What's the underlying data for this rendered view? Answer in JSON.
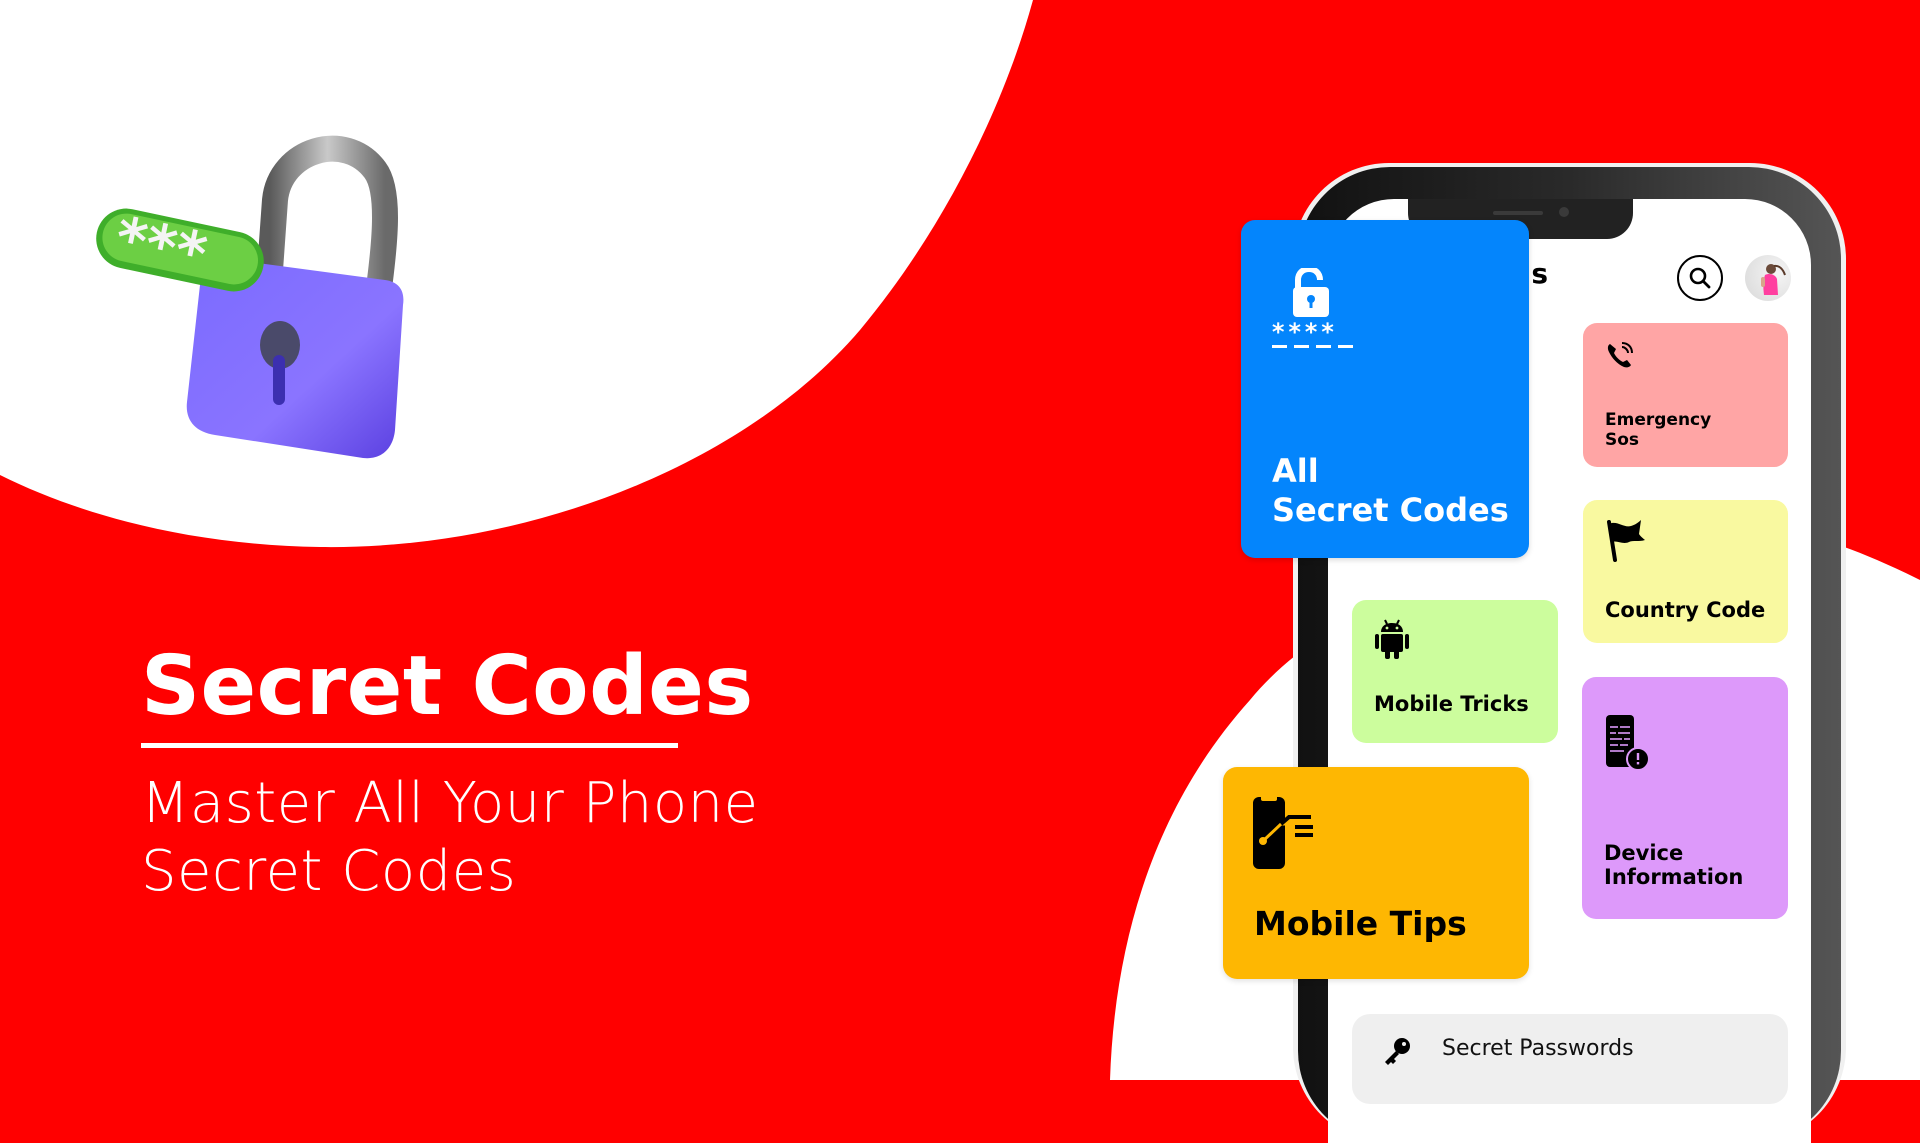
{
  "colors": {
    "background_red": "#ff0000",
    "background_white": "#ffffff",
    "all_codes_card": "#0485fc",
    "emergency_card": "#ffa5a5",
    "country_card": "#f9f9a0",
    "tricks_card": "#ccfd9d",
    "device_card": "#dd99fa",
    "tips_card": "#feb702",
    "passwords_bar": "#efefef"
  },
  "hero": {
    "title": "Secret Codes",
    "subtitle_line1": "Master All Your Phone",
    "subtitle_line2": "Secret Codes"
  },
  "illustration": {
    "icon": "padlock-with-password-icon",
    "password_mask": "***"
  },
  "app": {
    "header_title_partial": "s",
    "search_icon": "search-icon",
    "avatar": "user-avatar"
  },
  "cards": {
    "all_codes": {
      "icon": "lock-password-icon",
      "mask": "****",
      "line1": "All",
      "line2": "Secret Codes"
    },
    "emergency": {
      "icon": "phone-call-icon",
      "line1": "Emergency",
      "line2": "Sos"
    },
    "country": {
      "icon": "flag-icon",
      "label": "Country Code"
    },
    "tricks": {
      "icon": "android-icon",
      "label": "Mobile Tricks"
    },
    "device": {
      "icon": "device-info-icon",
      "line1": "Device",
      "line2": "Information"
    },
    "tips": {
      "icon": "mobile-tips-icon",
      "label": "Mobile Tips"
    }
  },
  "passwords": {
    "icon": "key-icon",
    "label": "Secret Passwords"
  }
}
